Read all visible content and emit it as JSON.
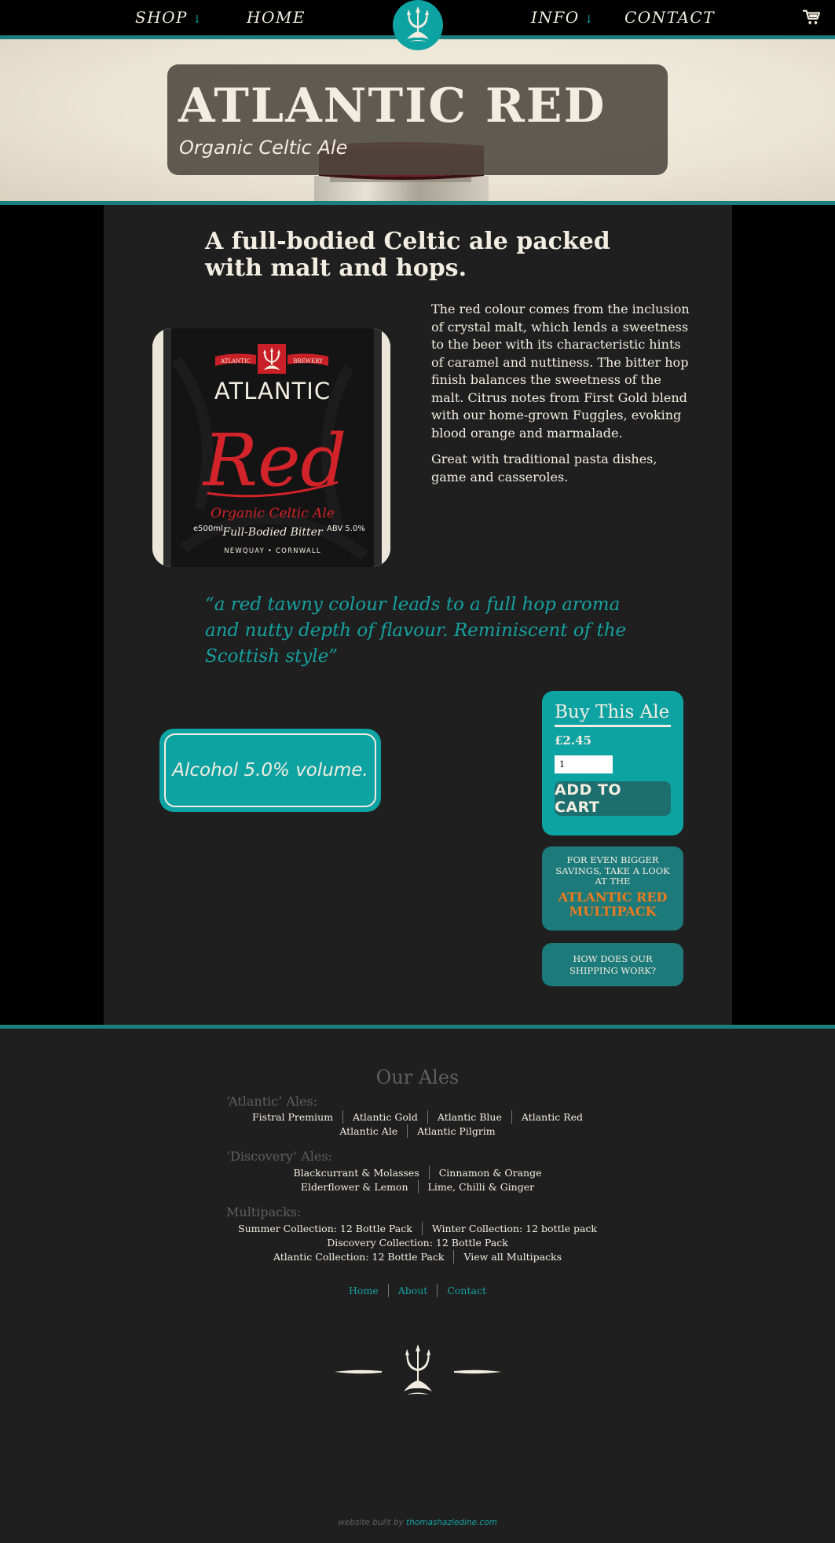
{
  "nav": {
    "shop_label": "SHOP",
    "home_label": "HOME",
    "info_label": "INFO",
    "contact_label": "CONTACT",
    "dropdown_arrow": "↓",
    "accent_color": "#0ea3a3",
    "cart_icon": "shopping-cart-icon",
    "logo_icon": "trident-icon"
  },
  "hero": {
    "title": "ATLANTIC RED",
    "subtitle": "Organic Celtic Ale"
  },
  "product": {
    "headline": "A full-bodied Celtic ale packed with malt and hops.",
    "description": [
      "The red colour comes from the inclusion of crystal malt, which lends a sweetness to the beer with its characteristic hints of caramel and nuttiness. The bitter hop finish balances the sweetness of the malt. Citrus notes from First Gold blend with our home-grown Fuggles, evoking blood orange and marmalade.",
      "Great with traditional pasta dishes, game and casseroles."
    ],
    "quote": "“a red tawny colour leads to a full hop aroma and nutty depth of flavour. Reminiscent of the Scottish style”",
    "abv": "Alcohol 5.0% volume.",
    "label": {
      "brand_left": "ATLANTIC",
      "brand_right": "BREWERY",
      "name": "ATLANTIC",
      "script": "Red",
      "type": "Organic Celtic Ale",
      "volume": "e500ml",
      "style": "Full-Bodied Bitter",
      "abv": "ABV 5.0%",
      "place": "NEWQUAY • CORNWALL"
    }
  },
  "buy": {
    "title": "Buy This Ale",
    "price": "£2.45",
    "quantity": "1",
    "add_to_cart": "ADD TO CART"
  },
  "promo": {
    "text": "FOR EVEN BIGGER SAVINGS, TAKE A LOOK AT THE",
    "link": "ATLANTIC RED MULTIPACK",
    "link_color": "#ee7a1c"
  },
  "shipping": {
    "text": "HOW DOES OUR SHIPPING WORK?"
  },
  "footer": {
    "heading": "Our Ales",
    "atlantic_label": "‘Atlantic’ Ales:",
    "atlantic_ales": [
      "Fistral Premium",
      "Atlantic Gold",
      "Atlantic Blue",
      "Atlantic Red",
      "Atlantic Ale",
      "Atlantic Pilgrim"
    ],
    "discovery_label": "‘Discovery’ Ales:",
    "discovery_ales": [
      "Blackcurrant & Molasses",
      "Cinnamon & Orange",
      "Elderflower & Lemon",
      "Lime, Chilli & Ginger"
    ],
    "multipacks_label": "Multipacks:",
    "multipacks": [
      "Summer Collection: 12 Bottle Pack",
      "Winter Collection: 12 bottle pack",
      "Discovery Collection: 12 Bottle Pack",
      "Atlantic Collection: 12 Bottle Pack",
      "View all Multipacks"
    ],
    "nav_links": [
      "Home",
      "About",
      "Contact"
    ],
    "credit_prefix": "website built by",
    "credit_link": "thomashazledine.com"
  }
}
